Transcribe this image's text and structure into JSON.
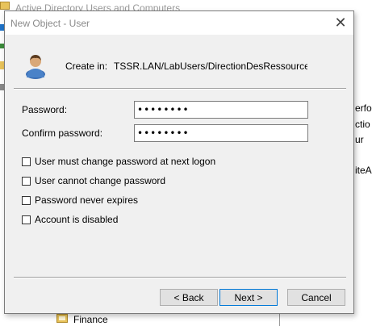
{
  "background_window": {
    "title": "Active Directory Users and Computers",
    "right_column_fragments": [
      "erfo",
      "ctio",
      "ur",
      "iteA"
    ],
    "tree_item": "Finance"
  },
  "dialog": {
    "title": "New Object - User",
    "close_glyph": "✕",
    "create_in_label": "Create in:",
    "create_in_path": "TSSR.LAN/LabUsers/DirectionDesRessourcesHumaines"
  },
  "form": {
    "password_label": "Password:",
    "password_value": "••••••••",
    "confirm_label": "Confirm password:",
    "confirm_value": "••••••••"
  },
  "options": [
    {
      "label": "User must change password at next logon",
      "checked": false
    },
    {
      "label": "User cannot change password",
      "checked": false
    },
    {
      "label": "Password never expires",
      "checked": false
    },
    {
      "label": "Account is disabled",
      "checked": false
    }
  ],
  "buttons": {
    "back": "< Back",
    "next": "Next >",
    "cancel": "Cancel"
  },
  "icons": {
    "user_icon": "user-icon",
    "close_icon": "close-icon",
    "folder_icon": "folder-icon"
  }
}
